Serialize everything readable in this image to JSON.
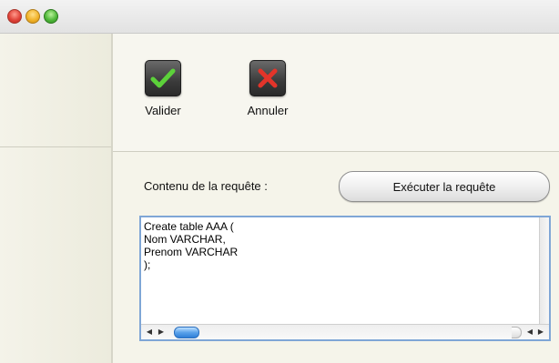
{
  "window": {
    "buttons": [
      "close",
      "minimize",
      "zoom"
    ]
  },
  "toolbar": {
    "valider_label": "Valider",
    "valider_icon": "checkmark-icon",
    "annuler_label": "Annuler",
    "annuler_icon": "x-icon"
  },
  "query": {
    "label": "Contenu de la requête :",
    "execute_label": "Exécuter la requête",
    "text": "Create table AAA (\nNom VARCHAR,\nPrenom VARCHAR\n);"
  },
  "colors": {
    "check_green": "#5cd13a",
    "cross_red": "#e3342a",
    "focus_blue": "#7fa6d6",
    "scroll_thumb": "#5aa2ea"
  }
}
